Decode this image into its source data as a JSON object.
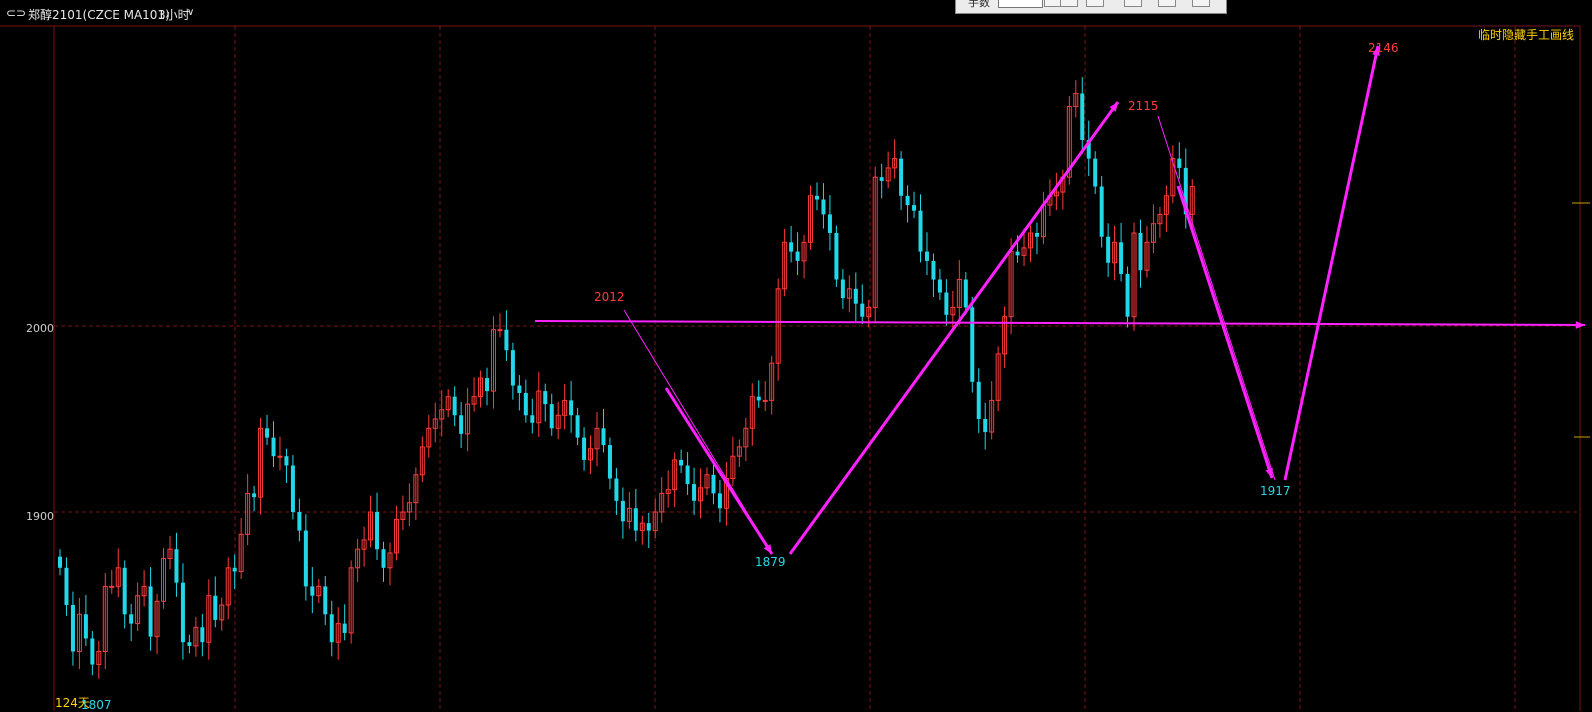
{
  "header": {
    "link_icon": "link-icon",
    "instrument": "郑醇2101(CZCE MA101)",
    "period": "3小时",
    "period_dropdown_icon": "chevron-down-icon"
  },
  "toolbar": {
    "label": "手数",
    "button_icons": [
      "dropdown-icon",
      "buy-icon",
      "sell-icon",
      "flat-icon",
      "reverse-icon",
      "settings-icon"
    ]
  },
  "notice": "临时隐藏手工画线",
  "y_axis": {
    "ticks": [
      2000,
      1900
    ]
  },
  "annotations": {
    "high_2012": "2012",
    "high_2115": "2115",
    "high_2146": "2146",
    "low_1879": "1879",
    "low_1917": "1917",
    "low_1807": "1807",
    "days": "124天"
  },
  "colors": {
    "background": "#000000",
    "up_candle": "#ff3a3a",
    "down_candle": "#22d8e8",
    "drawing": "#ff22ff",
    "grid": "#7a1414",
    "notice": "#ffd400"
  },
  "chart_data": {
    "type": "candlestick",
    "instrument": "郑醇2101(CZCE MA101)",
    "period": "3小时",
    "ylim": [
      1800,
      2160
    ],
    "horizontal_line": 2000,
    "key_points": [
      {
        "label": "2012",
        "value": 2012
      },
      {
        "label": "1879",
        "value": 1879
      },
      {
        "label": "2115",
        "value": 2115
      },
      {
        "label": "1917",
        "value": 1917
      },
      {
        "label": "2146",
        "value": 2146
      },
      {
        "label": "1807",
        "value": 1807
      }
    ],
    "closes": [
      1870,
      1850,
      1825,
      1845,
      1832,
      1818,
      1825,
      1860,
      1860,
      1870,
      1845,
      1840,
      1855,
      1860,
      1833,
      1852,
      1875,
      1880,
      1862,
      1830,
      1828,
      1838,
      1830,
      1855,
      1842,
      1850,
      1870,
      1868,
      1888,
      1910,
      1908,
      1945,
      1940,
      1930,
      1930,
      1925,
      1900,
      1890,
      1860,
      1855,
      1860,
      1845,
      1830,
      1840,
      1835,
      1870,
      1880,
      1885,
      1900,
      1880,
      1870,
      1878,
      1896,
      1900,
      1905,
      1920,
      1935,
      1945,
      1950,
      1955,
      1962,
      1952,
      1942,
      1958,
      1962,
      1972,
      1965,
      1998,
      1998,
      1987,
      1968,
      1964,
      1952,
      1948,
      1965,
      1958,
      1945,
      1952,
      1960,
      1952,
      1940,
      1928,
      1934,
      1945,
      1936,
      1918,
      1906,
      1895,
      1902,
      1890,
      1894,
      1890,
      1900,
      1910,
      1912,
      1928,
      1925,
      1915,
      1906,
      1913,
      1920,
      1910,
      1902,
      1918,
      1930,
      1935,
      1945,
      1962,
      1960,
      1960,
      1980,
      2020,
      2045,
      2040,
      2035,
      2045,
      2070,
      2068,
      2060,
      2050,
      2025,
      2015,
      2020,
      2012,
      2005,
      2010,
      2080,
      2078,
      2085,
      2090,
      2070,
      2065,
      2062,
      2040,
      2035,
      2025,
      2018,
      2006,
      2010,
      2025,
      2010,
      1970,
      1950,
      1943,
      1960,
      1985,
      2005,
      2040,
      2038,
      2042,
      2050,
      2048,
      2065,
      2070,
      2072,
      2080,
      2118,
      2125,
      2100,
      2090,
      2075,
      2048,
      2034,
      2045,
      2028,
      2005,
      2050,
      2030,
      2045,
      2055,
      2060,
      2070,
      2090,
      2085,
      2060,
      2075
    ]
  }
}
